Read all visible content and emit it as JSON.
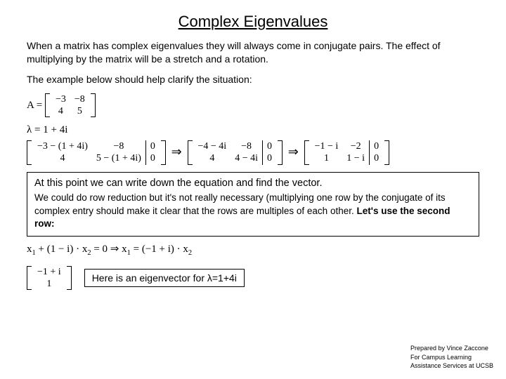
{
  "title": "Complex Eigenvalues",
  "para1": "When a matrix has complex eigenvalues they will always come in conjugate pairs. The effect of multiplying by the matrix will be a stretch and a rotation.",
  "para2": "The example below should help clarify the situation:",
  "matrixA": {
    "label": "A =",
    "r1c1": "−3",
    "r1c2": "−8",
    "r2c1": "4",
    "r2c2": "5"
  },
  "lambda": "λ = 1 + 4i",
  "step1": {
    "r1c1": "−3 − (1 + 4i)",
    "r1c2": "−8",
    "r1aug": "0",
    "r2c1": "4",
    "r2c2": "5 − (1 + 4i)",
    "r2aug": "0"
  },
  "step2": {
    "r1c1": "−4 − 4i",
    "r1c2": "−8",
    "r1aug": "0",
    "r2c1": "4",
    "r2c2": "4 − 4i",
    "r2aug": "0"
  },
  "step3": {
    "r1c1": "−1 − i",
    "r1c2": "−2",
    "r1aug": "0",
    "r2c1": "1",
    "r2c2": "1 − i",
    "r2aug": "0"
  },
  "implies": "⇒",
  "box": {
    "lead": "At this point we can write down the equation and find the vector.",
    "body": "We could do row reduction but it's not really necessary (multiplying one row by the conjugate of its complex entry should make it clear that the rows are multiples of each other. ",
    "bold": "Let's use the second row:"
  },
  "eq": {
    "lhs_a": "x",
    "lhs_b": " + (1 − i) · x",
    "lhs_c": " = 0 ⇒ x",
    "lhs_d": " = (−1 + i) · x"
  },
  "eigvec": {
    "r1": "−1 + i",
    "r2": "1"
  },
  "eig_caption": "Here is an eigenvector for λ=1+4i",
  "footer": {
    "l1": "Prepared by Vince Zaccone",
    "l2": "For Campus Learning",
    "l3": "Assistance Services at UCSB"
  }
}
